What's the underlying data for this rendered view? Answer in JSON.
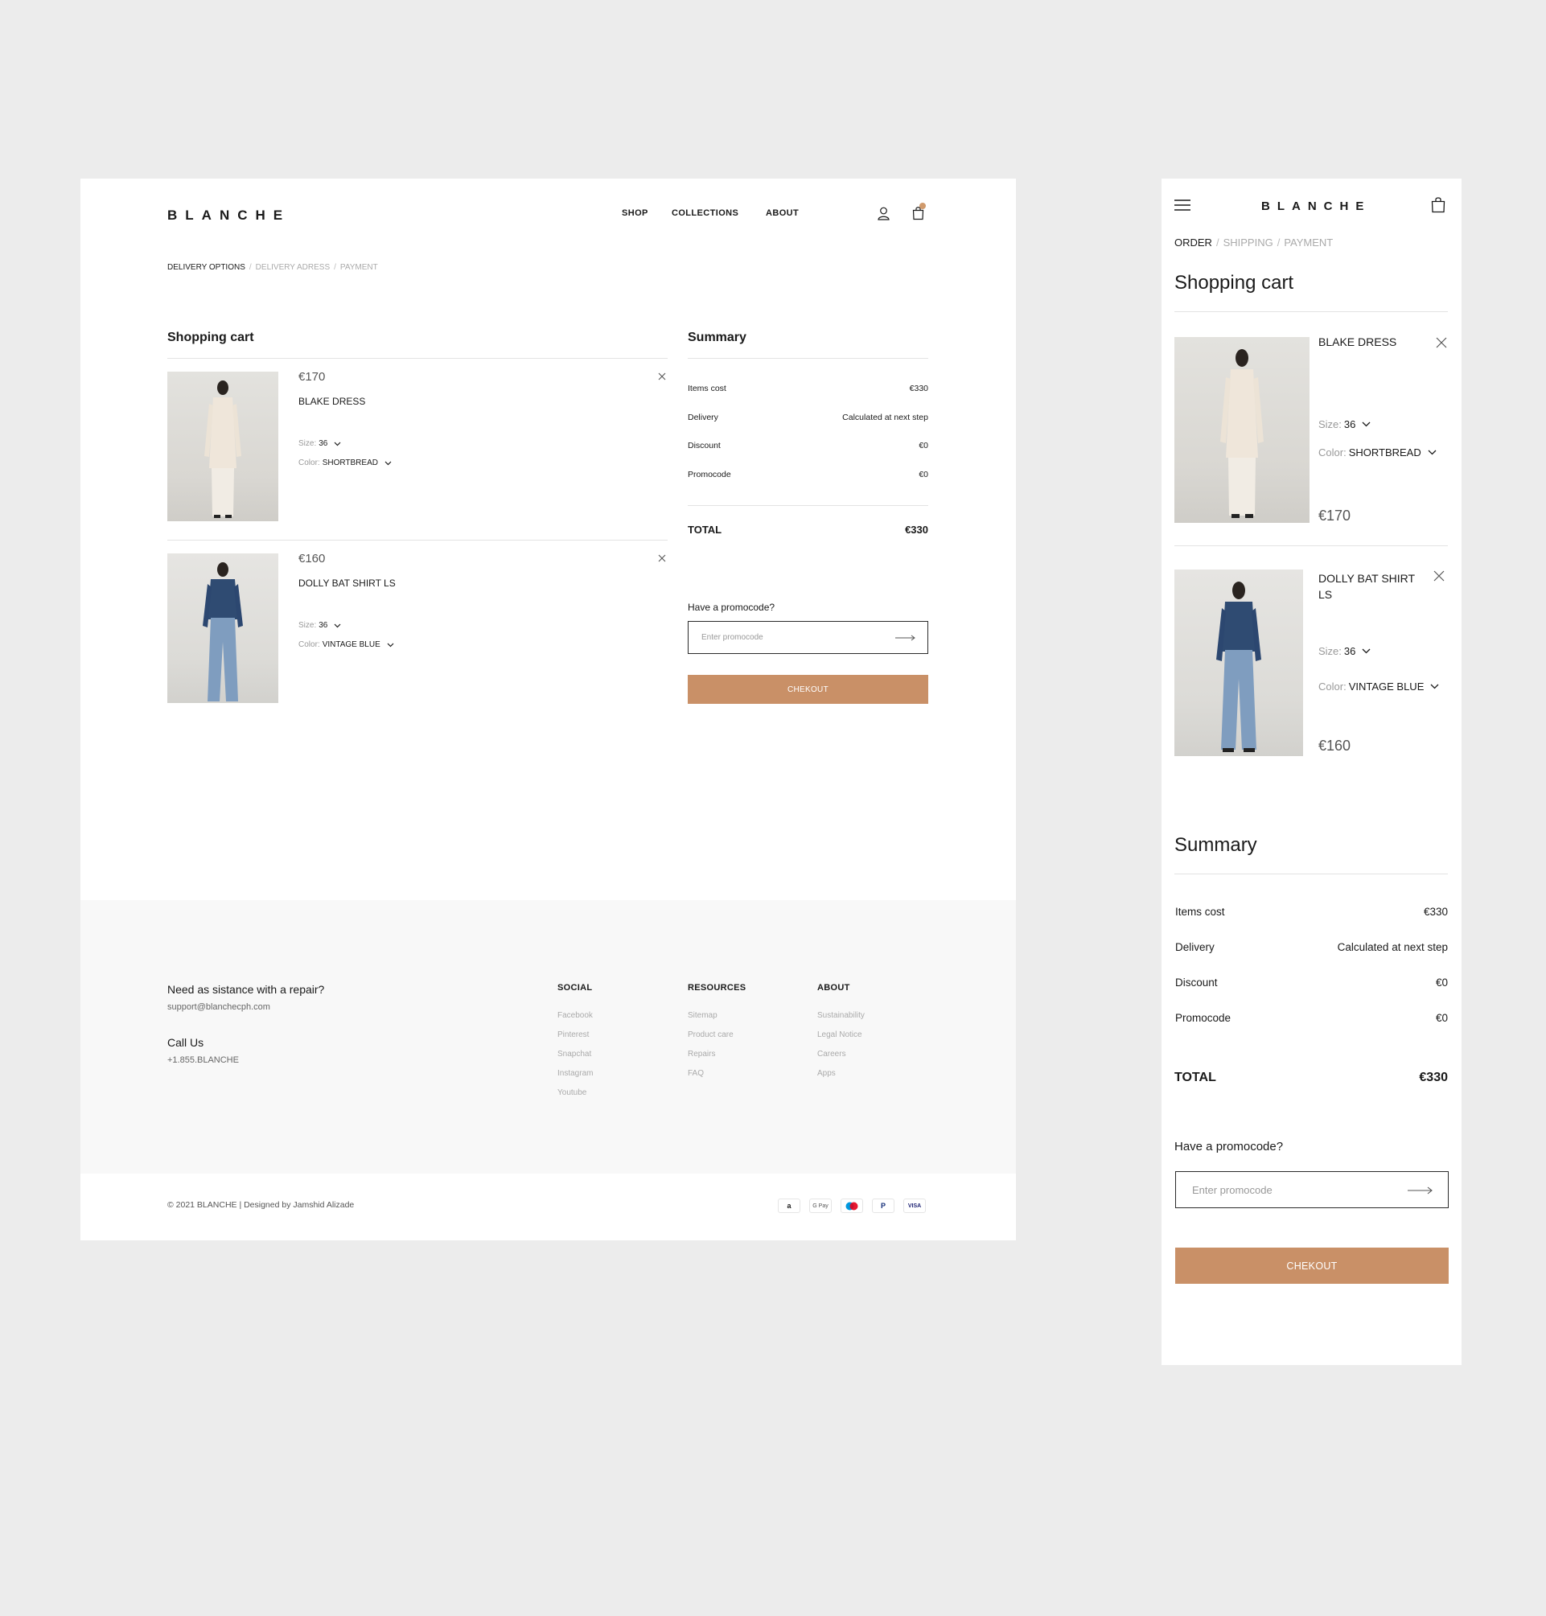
{
  "brand": "BLANCHE",
  "colors": {
    "accent": "#c99067",
    "cart_badge": "#d09a6c"
  },
  "desktop": {
    "nav": [
      "SHOP",
      "COLLECTIONS",
      "ABOUT"
    ],
    "icons": {
      "account": "user-icon",
      "cart": "shopping-bag-icon"
    },
    "breadcrumb": [
      "DELIVERY OPTIONS",
      "DELIVERY ADRESS",
      "PAYMENT"
    ],
    "cart_title": "Shopping cart",
    "items": [
      {
        "price": "€170",
        "name": "BLAKE DRESS",
        "size_label": "Size:",
        "size": "36",
        "color_label": "Color:",
        "color": "SHORTBREAD"
      },
      {
        "price": "€160",
        "name": "DOLLY BAT SHIRT LS",
        "size_label": "Size:",
        "size": "36",
        "color_label": "Color:",
        "color": "VINTAGE BLUE"
      }
    ],
    "summary": {
      "title": "Summary",
      "rows": [
        {
          "label": "Items cost",
          "value": "€330"
        },
        {
          "label": "Delivery",
          "value": "Calculated at next step"
        },
        {
          "label": "Discount",
          "value": "€0"
        },
        {
          "label": "Promocode",
          "value": "€0"
        }
      ],
      "total_label": "TOTAL",
      "total_value": "€330",
      "promo_question": "Have a promocode?",
      "promo_placeholder": "Enter promocode",
      "checkout": "CHEKOUT"
    },
    "footer": {
      "assist_title": "Need as sistance with a repair?",
      "assist_email": "support@blanchecph.com",
      "call_title": "Call Us",
      "call_number": "+1.855.BLANCHE",
      "columns": [
        {
          "title": "SOCIAL",
          "links": [
            "Facebook",
            "Pinterest",
            "Snapchat",
            "Instagram",
            "Youtube"
          ]
        },
        {
          "title": "RESOURCES",
          "links": [
            "Sitemap",
            "Product care",
            "Repairs",
            "FAQ"
          ]
        },
        {
          "title": "ABOUT",
          "links": [
            "Sustainability",
            "Legal Notice",
            "Careers",
            "Apps"
          ]
        }
      ],
      "copyright": "© 2021 BLANCHE | Designed by Jamshid Alizade",
      "payments": [
        {
          "label": "a",
          "icon": "amazon-pay-icon"
        },
        {
          "label": "G Pay",
          "icon": "google-pay-icon"
        },
        {
          "label": "",
          "icon": "maestro-icon"
        },
        {
          "label": "P",
          "icon": "paypal-icon"
        },
        {
          "label": "VISA",
          "icon": "visa-icon"
        }
      ]
    }
  },
  "mobile": {
    "icons": {
      "menu": "hamburger-menu-icon",
      "cart": "shopping-bag-icon"
    },
    "breadcrumb": [
      "ORDER",
      "SHIPPING",
      "PAYMENT"
    ],
    "cart_title": "Shopping cart",
    "items": [
      {
        "name": "BLAKE DRESS",
        "size_label": "Size:",
        "size": "36",
        "color_label": "Color:",
        "color": "SHORTBREAD",
        "price": "€170"
      },
      {
        "name_line1": "DOLLY BAT SHIRT",
        "name_line2": "LS",
        "size_label": "Size:",
        "size": "36",
        "color_label": "Color:",
        "color": "VINTAGE BLUE",
        "price": "€160"
      }
    ],
    "summary": {
      "title": "Summary",
      "rows": [
        {
          "label": "Items cost",
          "value": "€330"
        },
        {
          "label": "Delivery",
          "value": "Calculated at next step"
        },
        {
          "label": "Discount",
          "value": "€0"
        },
        {
          "label": "Promocode",
          "value": "€0"
        }
      ],
      "total_label": "TOTAL",
      "total_value": "€330",
      "promo_question": "Have a promocode?",
      "promo_placeholder": "Enter promocode",
      "checkout": "CHEKOUT"
    }
  }
}
